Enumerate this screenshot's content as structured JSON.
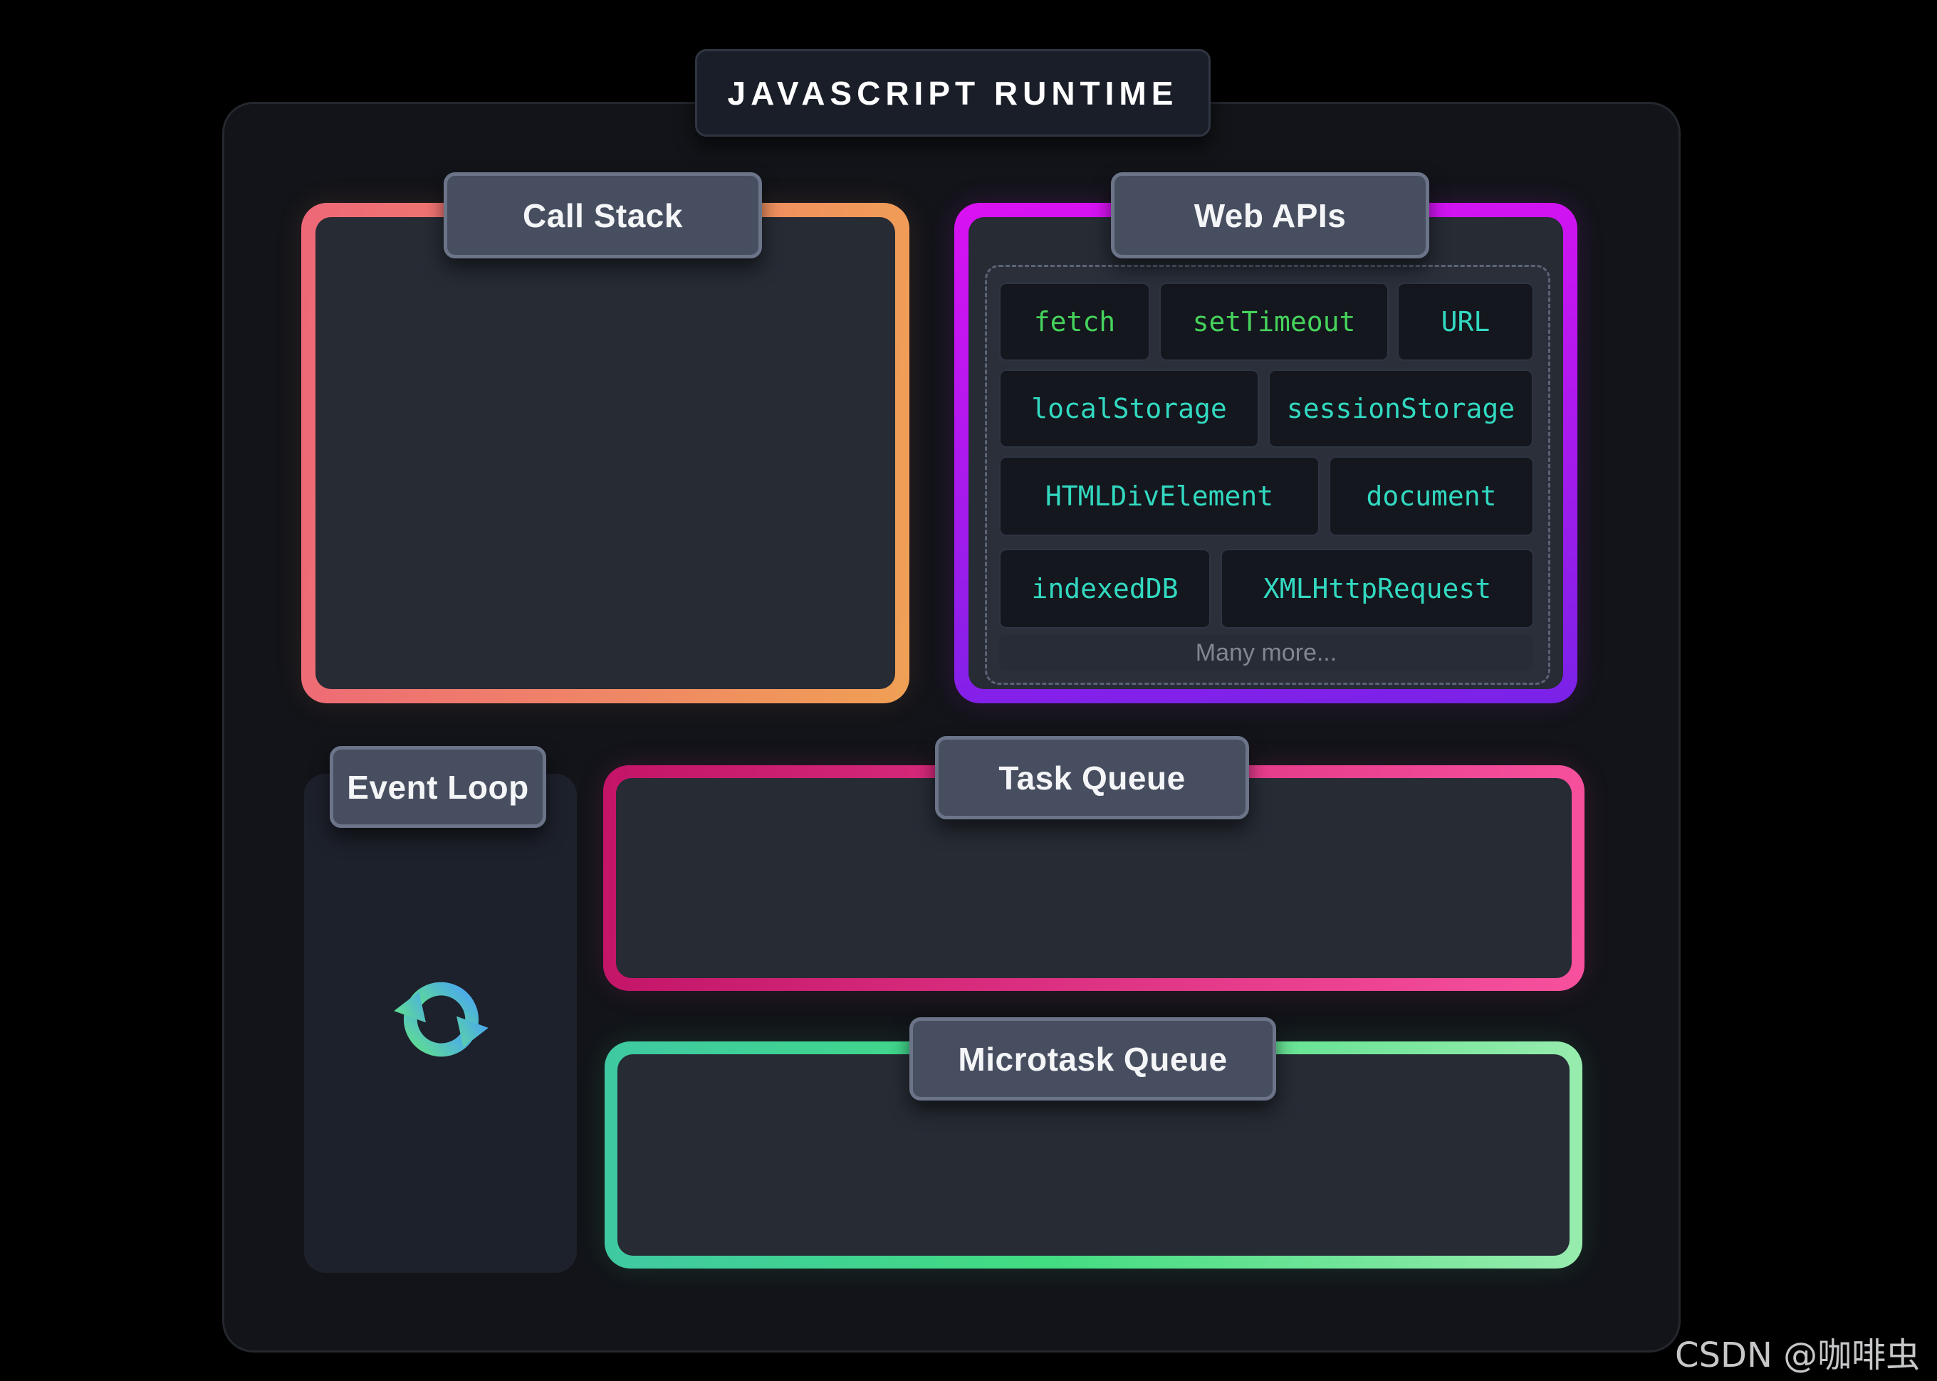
{
  "title": "JAVASCRIPT RUNTIME",
  "panels": {
    "call_stack": {
      "label": "Call Stack"
    },
    "web_apis": {
      "label": "Web APIs",
      "chips": [
        {
          "label": "fetch",
          "color": "green"
        },
        {
          "label": "setTimeout",
          "color": "green"
        },
        {
          "label": "URL",
          "color": "teal"
        },
        {
          "label": "localStorage",
          "color": "teal"
        },
        {
          "label": "sessionStorage",
          "color": "teal"
        },
        {
          "label": "HTMLDivElement",
          "color": "teal"
        },
        {
          "label": "document",
          "color": "teal"
        },
        {
          "label": "indexedDB",
          "color": "teal"
        },
        {
          "label": "XMLHttpRequest",
          "color": "teal"
        }
      ],
      "more_label": "Many more..."
    },
    "event_loop": {
      "label": "Event Loop",
      "icon": "sync-loop-icon"
    },
    "task_queue": {
      "label": "Task Queue"
    },
    "microtask_queue": {
      "label": "Microtask Queue"
    }
  },
  "watermark": "CSDN @咖啡虫",
  "colors": {
    "background": "#000000",
    "container": "#121419",
    "panel_interior": "#262b34",
    "label_box": "#474e60",
    "call_stack_border_start": "#ee6878",
    "call_stack_border_end": "#f0a055",
    "web_apis_border_start": "#da12f2",
    "web_apis_border_end": "#7a22e8",
    "task_queue_border_start": "#c31468",
    "task_queue_border_end": "#f7519e",
    "microtask_border_start": "#3fc9a2",
    "microtask_border_end": "#97ecad",
    "chip_green_text": "#46d35c",
    "chip_teal_text": "#32d9c1",
    "loop_icon_green": "#5fdd92",
    "loop_icon_blue": "#4aa7f0"
  }
}
